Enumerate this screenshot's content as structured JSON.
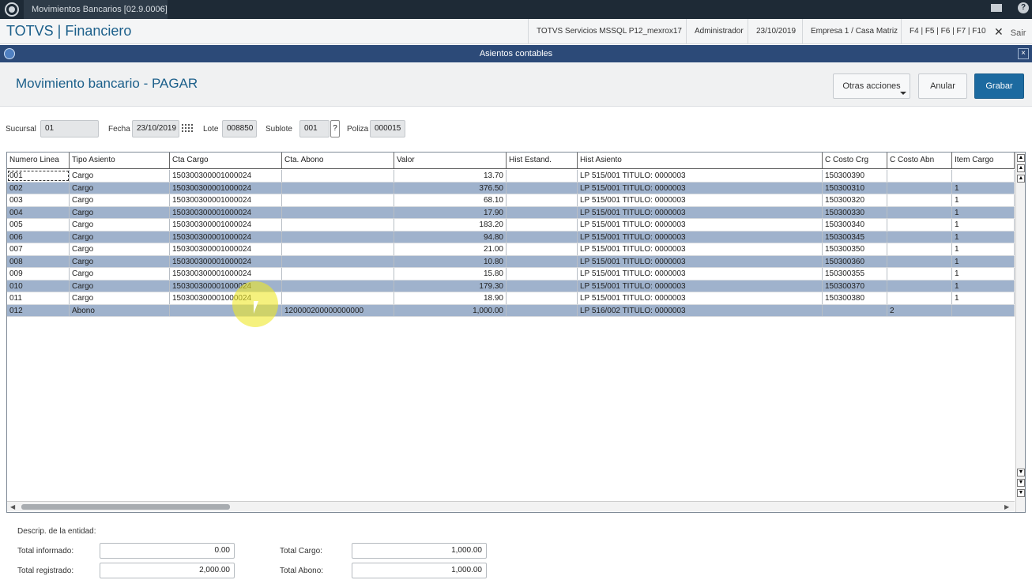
{
  "topbar": {
    "tab_title": "Movimientos Bancarios [02.9.0006]",
    "tab_close": "×",
    "help": "?"
  },
  "header": {
    "brand": "TOTVS | Financiero",
    "env": "TOTVS Servicios MSSQL P12_mexrox17",
    "user": "Administrador",
    "date": "23/10/2019",
    "company": "Empresa 1 / Casa Matriz",
    "shortcuts": "F4 | F5 | F6 | F7 | F10",
    "exit_label": "Sair",
    "exit_icon": "✕"
  },
  "dialog": {
    "title": "Asientos contables",
    "close": "×"
  },
  "page": {
    "title": "Movimiento bancario - PAGAR",
    "btn_other": "Otras acciones",
    "btn_cancel": "Anular",
    "btn_save": "Grabar"
  },
  "form": {
    "sucursal_label": "Sucursal",
    "sucursal": "01",
    "fecha_label": "Fecha",
    "fecha": "23/10/2019",
    "lote_label": "Lote",
    "lote": "008850",
    "sublote_label": "Sublote",
    "sublote": "001",
    "sublote_help": "?",
    "poliza_label": "Poliza",
    "poliza": "000015"
  },
  "grid": {
    "columns": [
      "Numero Linea",
      "Tipo Asiento",
      "Cta Cargo",
      "Cta. Abono",
      "Valor",
      "Hist Estand.",
      "Hist Asiento",
      "C Costo Crg",
      "C Costo Abn",
      "Item Cargo"
    ],
    "rows": [
      [
        "001",
        "Cargo",
        "150300300001000024",
        "",
        "13.70",
        "",
        "LP 515/001 TITULO: 0000003",
        "150300390",
        "",
        ""
      ],
      [
        "002",
        "Cargo",
        "150300300001000024",
        "",
        "376.50",
        "",
        "LP 515/001 TITULO: 0000003",
        "150300310",
        "",
        "1"
      ],
      [
        "003",
        "Cargo",
        "150300300001000024",
        "",
        "68.10",
        "",
        "LP 515/001 TITULO: 0000003",
        "150300320",
        "",
        "1"
      ],
      [
        "004",
        "Cargo",
        "150300300001000024",
        "",
        "17.90",
        "",
        "LP 515/001 TITULO: 0000003",
        "150300330",
        "",
        "1"
      ],
      [
        "005",
        "Cargo",
        "150300300001000024",
        "",
        "183.20",
        "",
        "LP 515/001 TITULO: 0000003",
        "150300340",
        "",
        "1"
      ],
      [
        "006",
        "Cargo",
        "150300300001000024",
        "",
        "94.80",
        "",
        "LP 515/001 TITULO: 0000003",
        "150300345",
        "",
        "1"
      ],
      [
        "007",
        "Cargo",
        "150300300001000024",
        "",
        "21.00",
        "",
        "LP 515/001 TITULO: 0000003",
        "150300350",
        "",
        "1"
      ],
      [
        "008",
        "Cargo",
        "150300300001000024",
        "",
        "10.80",
        "",
        "LP 515/001 TITULO: 0000003",
        "150300360",
        "",
        "1"
      ],
      [
        "009",
        "Cargo",
        "150300300001000024",
        "",
        "15.80",
        "",
        "LP 515/001 TITULO: 0000003",
        "150300355",
        "",
        "1"
      ],
      [
        "010",
        "Cargo",
        "150300300001000024",
        "",
        "179.30",
        "",
        "LP 515/001 TITULO: 0000003",
        "150300370",
        "",
        "1"
      ],
      [
        "011",
        "Cargo",
        "150300300001000024",
        "",
        "18.90",
        "",
        "LP 515/001 TITULO: 0000003",
        "150300380",
        "",
        "1"
      ],
      [
        "012",
        "Abono",
        "",
        "120000200000000000",
        "1,000.00",
        "",
        "LP 516/002 TITULO: 0000003",
        "",
        "2",
        ""
      ]
    ]
  },
  "footer": {
    "descrip_label": "Descrip. de la entidad:",
    "total_informado_label": "Total informado:",
    "total_informado": "0.00",
    "total_registrado_label": "Total registrado:",
    "total_registrado": "2,000.00",
    "total_cargo_label": "Total Cargo:",
    "total_cargo": "1,000.00",
    "total_abono_label": "Total Abono:",
    "total_abono": "1,000.00"
  },
  "colors": {
    "brand": "#1b5f8a",
    "dialog_bar": "#2c4a78",
    "row_alt": "#9fb2cc",
    "primary_button": "#1c6aa0"
  }
}
